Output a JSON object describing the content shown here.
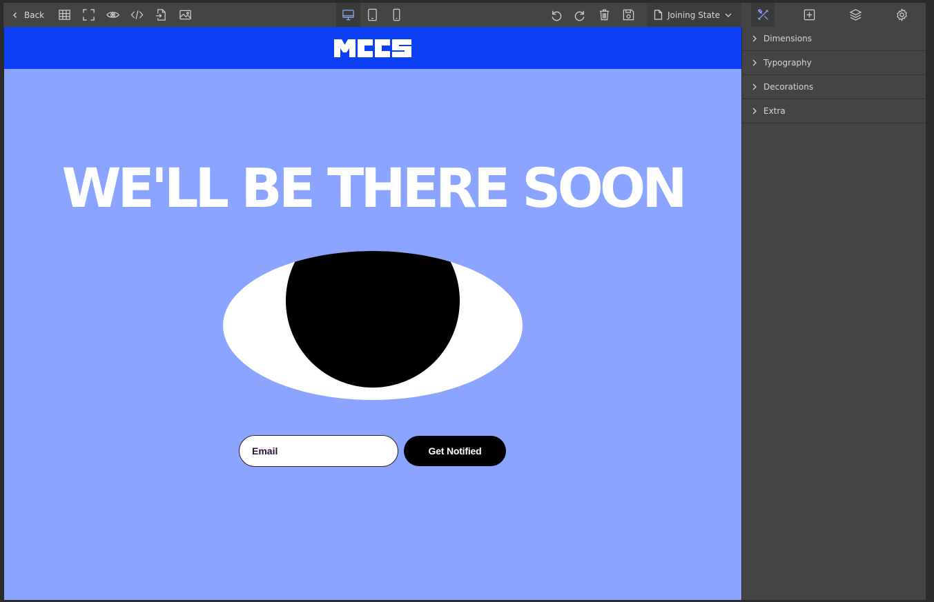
{
  "toolbar": {
    "back_label": "Back",
    "left_icons": [
      "grid-icon",
      "fullscreen-icon",
      "eye-preview-icon",
      "code-icon",
      "import-icon",
      "image-icon"
    ],
    "device_icons": [
      "desktop-icon",
      "tablet-icon",
      "mobile-icon"
    ],
    "active_device": "desktop-icon",
    "right_icons": [
      "undo-icon",
      "redo-icon",
      "trash-icon",
      "save-icon"
    ],
    "state_select": {
      "value": "Joining State"
    },
    "panel_tabs": [
      "style-manager-icon",
      "add-block-icon",
      "layers-icon",
      "settings-icon"
    ],
    "active_panel_tab": "style-manager-icon",
    "accent_color": "#8fa9ff"
  },
  "page": {
    "logo_alt": "MCCS",
    "header_color": "#0d3ff4",
    "background_color": "#8aa4ff",
    "hero_title": "WE'LL BE THERE SOON",
    "email_placeholder": "Email",
    "button_label": "Get Notified"
  },
  "side_panel": {
    "sections": [
      {
        "label": "Dimensions"
      },
      {
        "label": "Typography"
      },
      {
        "label": "Decorations"
      },
      {
        "label": "Extra"
      }
    ]
  }
}
